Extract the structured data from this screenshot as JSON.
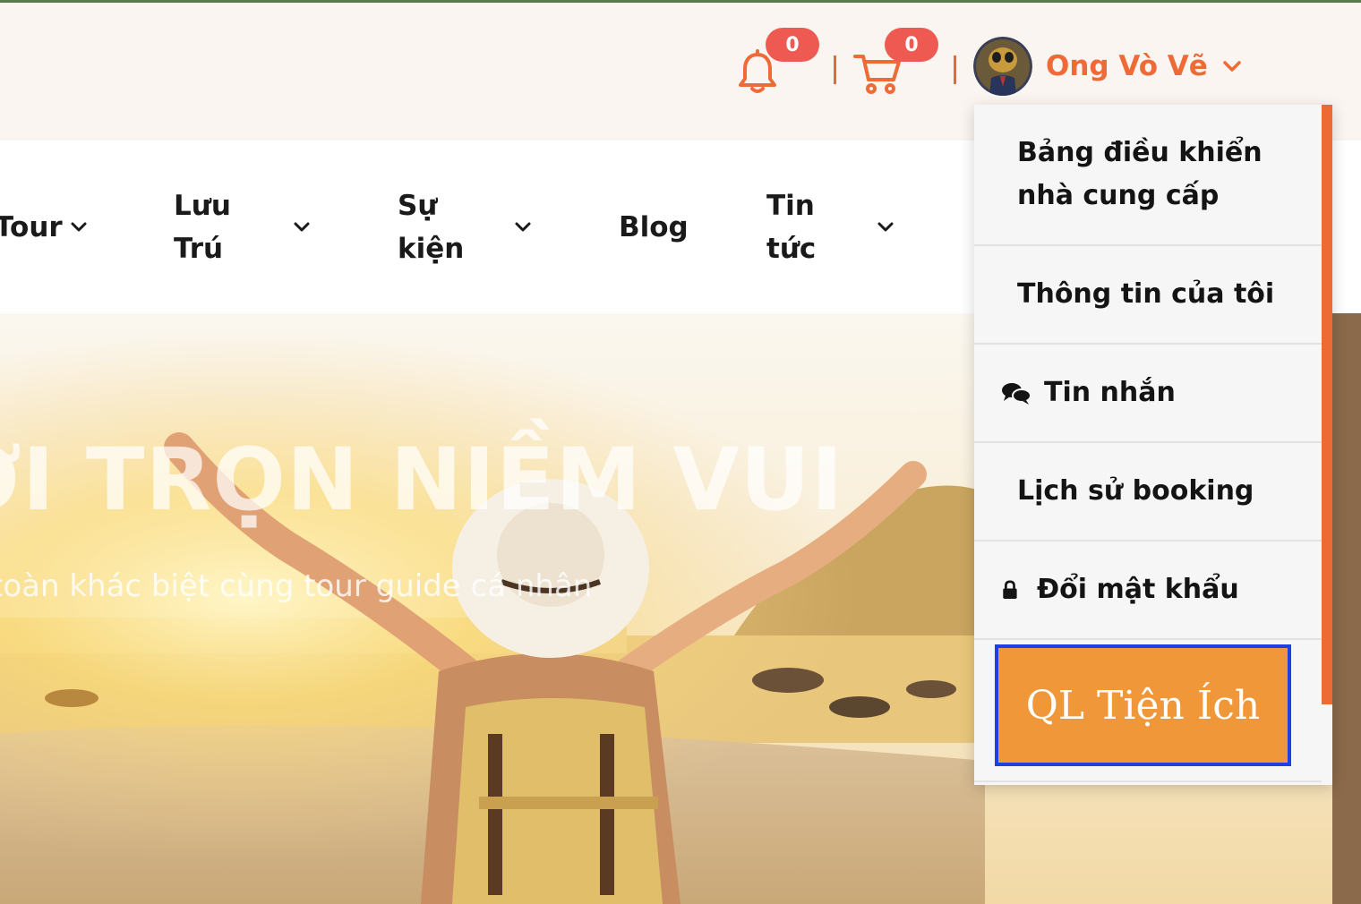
{
  "header": {
    "notifications_count": "0",
    "cart_count": "0",
    "user_name": "Ong Vò Vẽ"
  },
  "nav": {
    "items": [
      {
        "label": "Tour"
      },
      {
        "label": "Lưu Trú"
      },
      {
        "label": "Sự kiện"
      },
      {
        "label": "Blog"
      },
      {
        "label": "Tin tức"
      }
    ]
  },
  "hero": {
    "title": "ỜI TRỌN NIỀM VUI",
    "subtitle": "toàn khác biệt cùng tour guide cá nhân"
  },
  "dropdown": {
    "items": [
      {
        "label_line1": "Bảng điều khiển",
        "label_line2": "nhà cung cấp"
      },
      {
        "label": "Thông tin của tôi"
      },
      {
        "label": "Tin nhắn",
        "icon": "comments-icon"
      },
      {
        "label": "Lịch sử booking"
      },
      {
        "label": "Đổi mật khẩu",
        "icon": "lock-icon"
      }
    ],
    "utility_button": "QL Tiện Ích"
  },
  "colors": {
    "accent": "#ee6a36",
    "badge": "#ee5a52",
    "utility_button": "#f0973a",
    "focus_outline": "#1f3fe0"
  }
}
